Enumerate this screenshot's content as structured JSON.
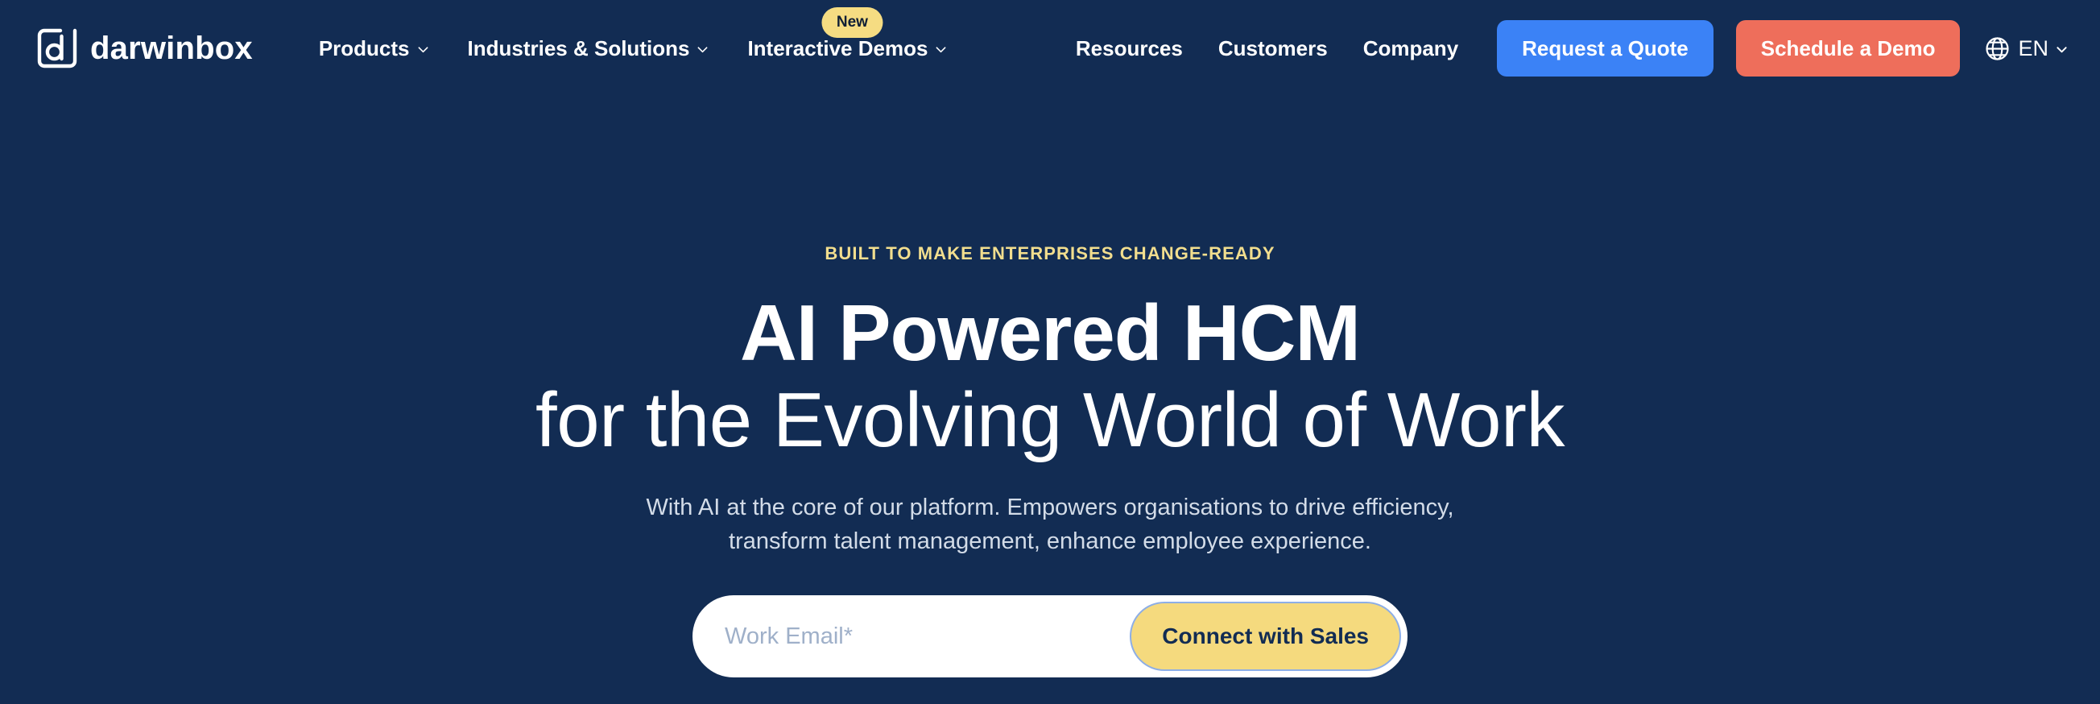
{
  "theme": {
    "background": "#122C53",
    "accent_yellow": "#F5DA7E",
    "accent_blue": "#3B82F6",
    "accent_coral": "#EE6E5B",
    "eyebrow_yellow": "#F2DE8E",
    "text_white": "#FFFFFF"
  },
  "header": {
    "brand": {
      "logo_icon": "darwinbox-bracket-d-logo",
      "wordmark": "darwinbox"
    },
    "nav_left": [
      {
        "label": "Products",
        "icon": "chevron-down-icon",
        "badge": null
      },
      {
        "label": "Industries & Solutions",
        "icon": "chevron-down-icon",
        "badge": null
      },
      {
        "label": "Interactive Demos",
        "icon": "chevron-down-icon",
        "badge": "New"
      }
    ],
    "nav_right": [
      {
        "label": "Resources"
      },
      {
        "label": "Customers"
      },
      {
        "label": "Company"
      }
    ],
    "cta_primary": {
      "label": "Request a Quote",
      "color": "#3B82F6"
    },
    "cta_secondary": {
      "label": "Schedule a Demo",
      "color": "#EE6E5B"
    },
    "language": {
      "icon": "globe-icon",
      "code": "EN",
      "chevron": "chevron-down-icon"
    }
  },
  "hero": {
    "eyebrow": "BUILT TO MAKE ENTERPRISES CHANGE-READY",
    "title_line_1": "AI Powered HCM",
    "title_line_2": "for the Evolving World of Work",
    "subtitle": "With AI at the core of our platform. Empowers organisations to drive efficiency, transform talent management, enhance employee experience.",
    "form": {
      "email_placeholder": "Work Email*",
      "email_value": "",
      "submit_label": "Connect with Sales"
    }
  }
}
